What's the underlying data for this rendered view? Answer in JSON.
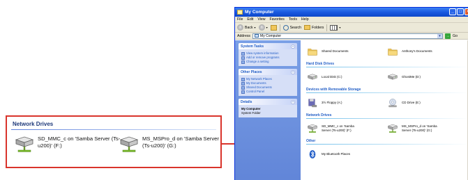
{
  "callout": {
    "title": "Network Drives",
    "items": [
      {
        "label": "SD_MMC_c on 'Samba Server (Ts-u200)' (F:)",
        "icon": "network-drive-icon"
      },
      {
        "label": "MS_MSPro_d on 'Samba Server (Ts-u200)' (G:)",
        "icon": "network-drive-icon"
      }
    ]
  },
  "window": {
    "title": "My Computer",
    "menu": [
      "File",
      "Edit",
      "View",
      "Favorites",
      "Tools",
      "Help"
    ],
    "toolbar": {
      "back": "Back",
      "search": "Search",
      "folders": "Folders"
    },
    "address": {
      "label": "Address",
      "value": "My Computer",
      "go": "Go"
    }
  },
  "tasks": {
    "system": {
      "title": "System Tasks",
      "items": [
        "View system information",
        "Add or remove programs",
        "Change a setting"
      ]
    },
    "other": {
      "title": "Other Places",
      "items": [
        "My Network Places",
        "My Documents",
        "Shared Documents",
        "Control Panel"
      ]
    },
    "details": {
      "title": "Details",
      "name": "My Computer",
      "type": "System Folder"
    }
  },
  "sections": {
    "shared": {
      "items": [
        "Shared Documents",
        "Anthony's Documents"
      ]
    },
    "hard": {
      "title": "Hard Disk Drives",
      "items": [
        "Local Disk (C:)",
        "GhostMe (D:)"
      ]
    },
    "removable": {
      "title": "Devices with Removable Storage",
      "items": [
        "3½ Floppy (A:)",
        "CD Drive (E:)"
      ]
    },
    "network": {
      "title": "Network Drives",
      "items": [
        "SD_MMC_c on 'Samba Server (Ts-u200)' (F:)",
        "MS_MSPro_d on 'Samba Server (Ts-u200)' (G:)"
      ]
    },
    "other": {
      "title": "Other",
      "items": [
        "My Bluetooth Places"
      ]
    }
  },
  "colors": {
    "accent": "#d9342b",
    "title_bar": "#1a5ae0",
    "task_pane": "#6185d8",
    "section_heading": "#215dc6"
  }
}
